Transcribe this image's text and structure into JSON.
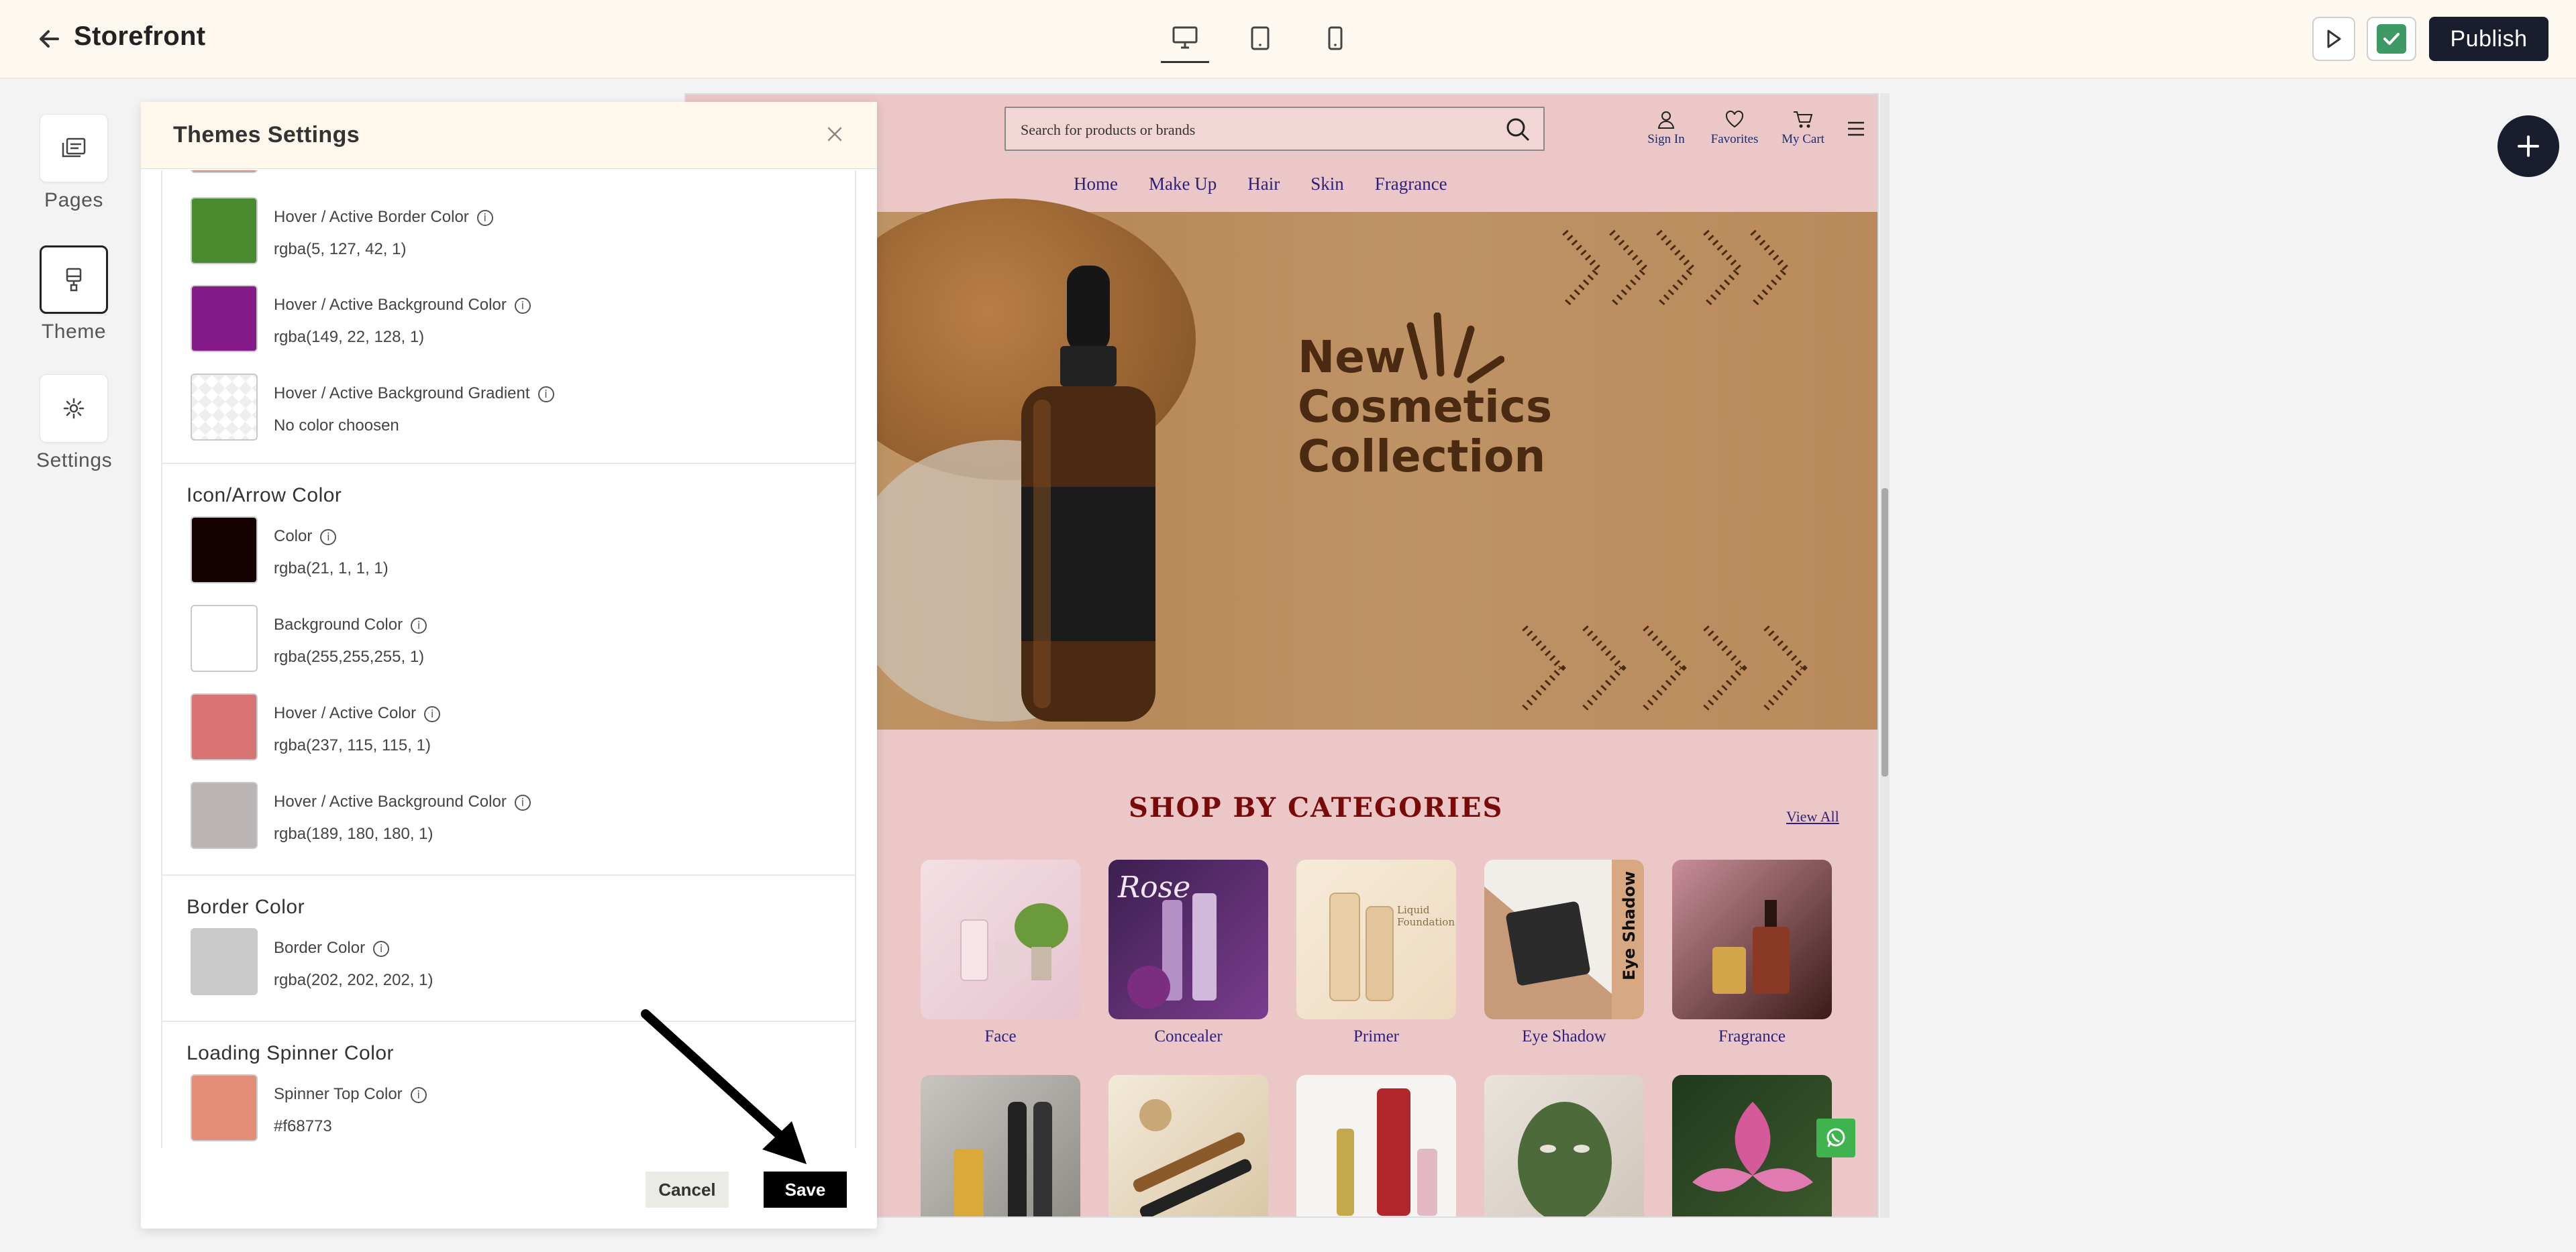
{
  "app": {
    "title": "Storefront"
  },
  "header": {
    "publish_label": "Publish"
  },
  "rail": {
    "items": [
      {
        "label": "Pages"
      },
      {
        "label": "Theme"
      },
      {
        "label": "Settings"
      }
    ]
  },
  "panel": {
    "title": "Themes Settings",
    "groups": {
      "g1": {
        "items": [
          {
            "label": "Hover / Active Border Color",
            "value": "rgba(5, 127, 42, 1)",
            "color": "#4a8a2e"
          },
          {
            "label": "Hover / Active Background Color",
            "value": "rgba(149, 22, 128, 1)",
            "color": "#851b88"
          },
          {
            "label": "Hover / Active Background Gradient",
            "value": "No color choosen",
            "color": ""
          }
        ]
      },
      "icon": {
        "title": "Icon/Arrow Color",
        "items": [
          {
            "label": "Color",
            "value": "rgba(21, 1, 1, 1)",
            "color": "#150101"
          },
          {
            "label": "Background Color",
            "value": "rgba(255,255,255, 1)",
            "color": "#ffffff"
          },
          {
            "label": "Hover / Active Color",
            "value": "rgba(237, 115, 115, 1)",
            "color": "#d97474"
          },
          {
            "label": "Hover / Active Background Color",
            "value": "rgba(189, 180, 180, 1)",
            "color": "#bab4b4"
          }
        ]
      },
      "border": {
        "title": "Border Color",
        "items": [
          {
            "label": "Border Color",
            "value": "rgba(202, 202, 202, 1)",
            "color": "#cacaca"
          }
        ]
      },
      "spinner": {
        "title": "Loading Spinner Color",
        "items": [
          {
            "label": "Spinner Top Color",
            "value": "#f68773",
            "color": "#e38d76"
          }
        ]
      }
    },
    "cancel_label": "Cancel",
    "save_label": "Save"
  },
  "preview": {
    "search_placeholder": "Search for products or brands",
    "icons": [
      {
        "label": "Sign In"
      },
      {
        "label": "Favorites"
      },
      {
        "label": "My Cart"
      }
    ],
    "nav": [
      "Home",
      "Make Up",
      "Hair",
      "Skin",
      "Fragrance"
    ],
    "hero_title": [
      "New",
      "Cosmetics",
      "Collection"
    ],
    "shop_title": "SHOP BY CATEGORIES",
    "view_all": "View All",
    "categories_row1": [
      "Face",
      "Concealer",
      "Primer",
      "Eye Shadow",
      "Fragrance"
    ]
  }
}
